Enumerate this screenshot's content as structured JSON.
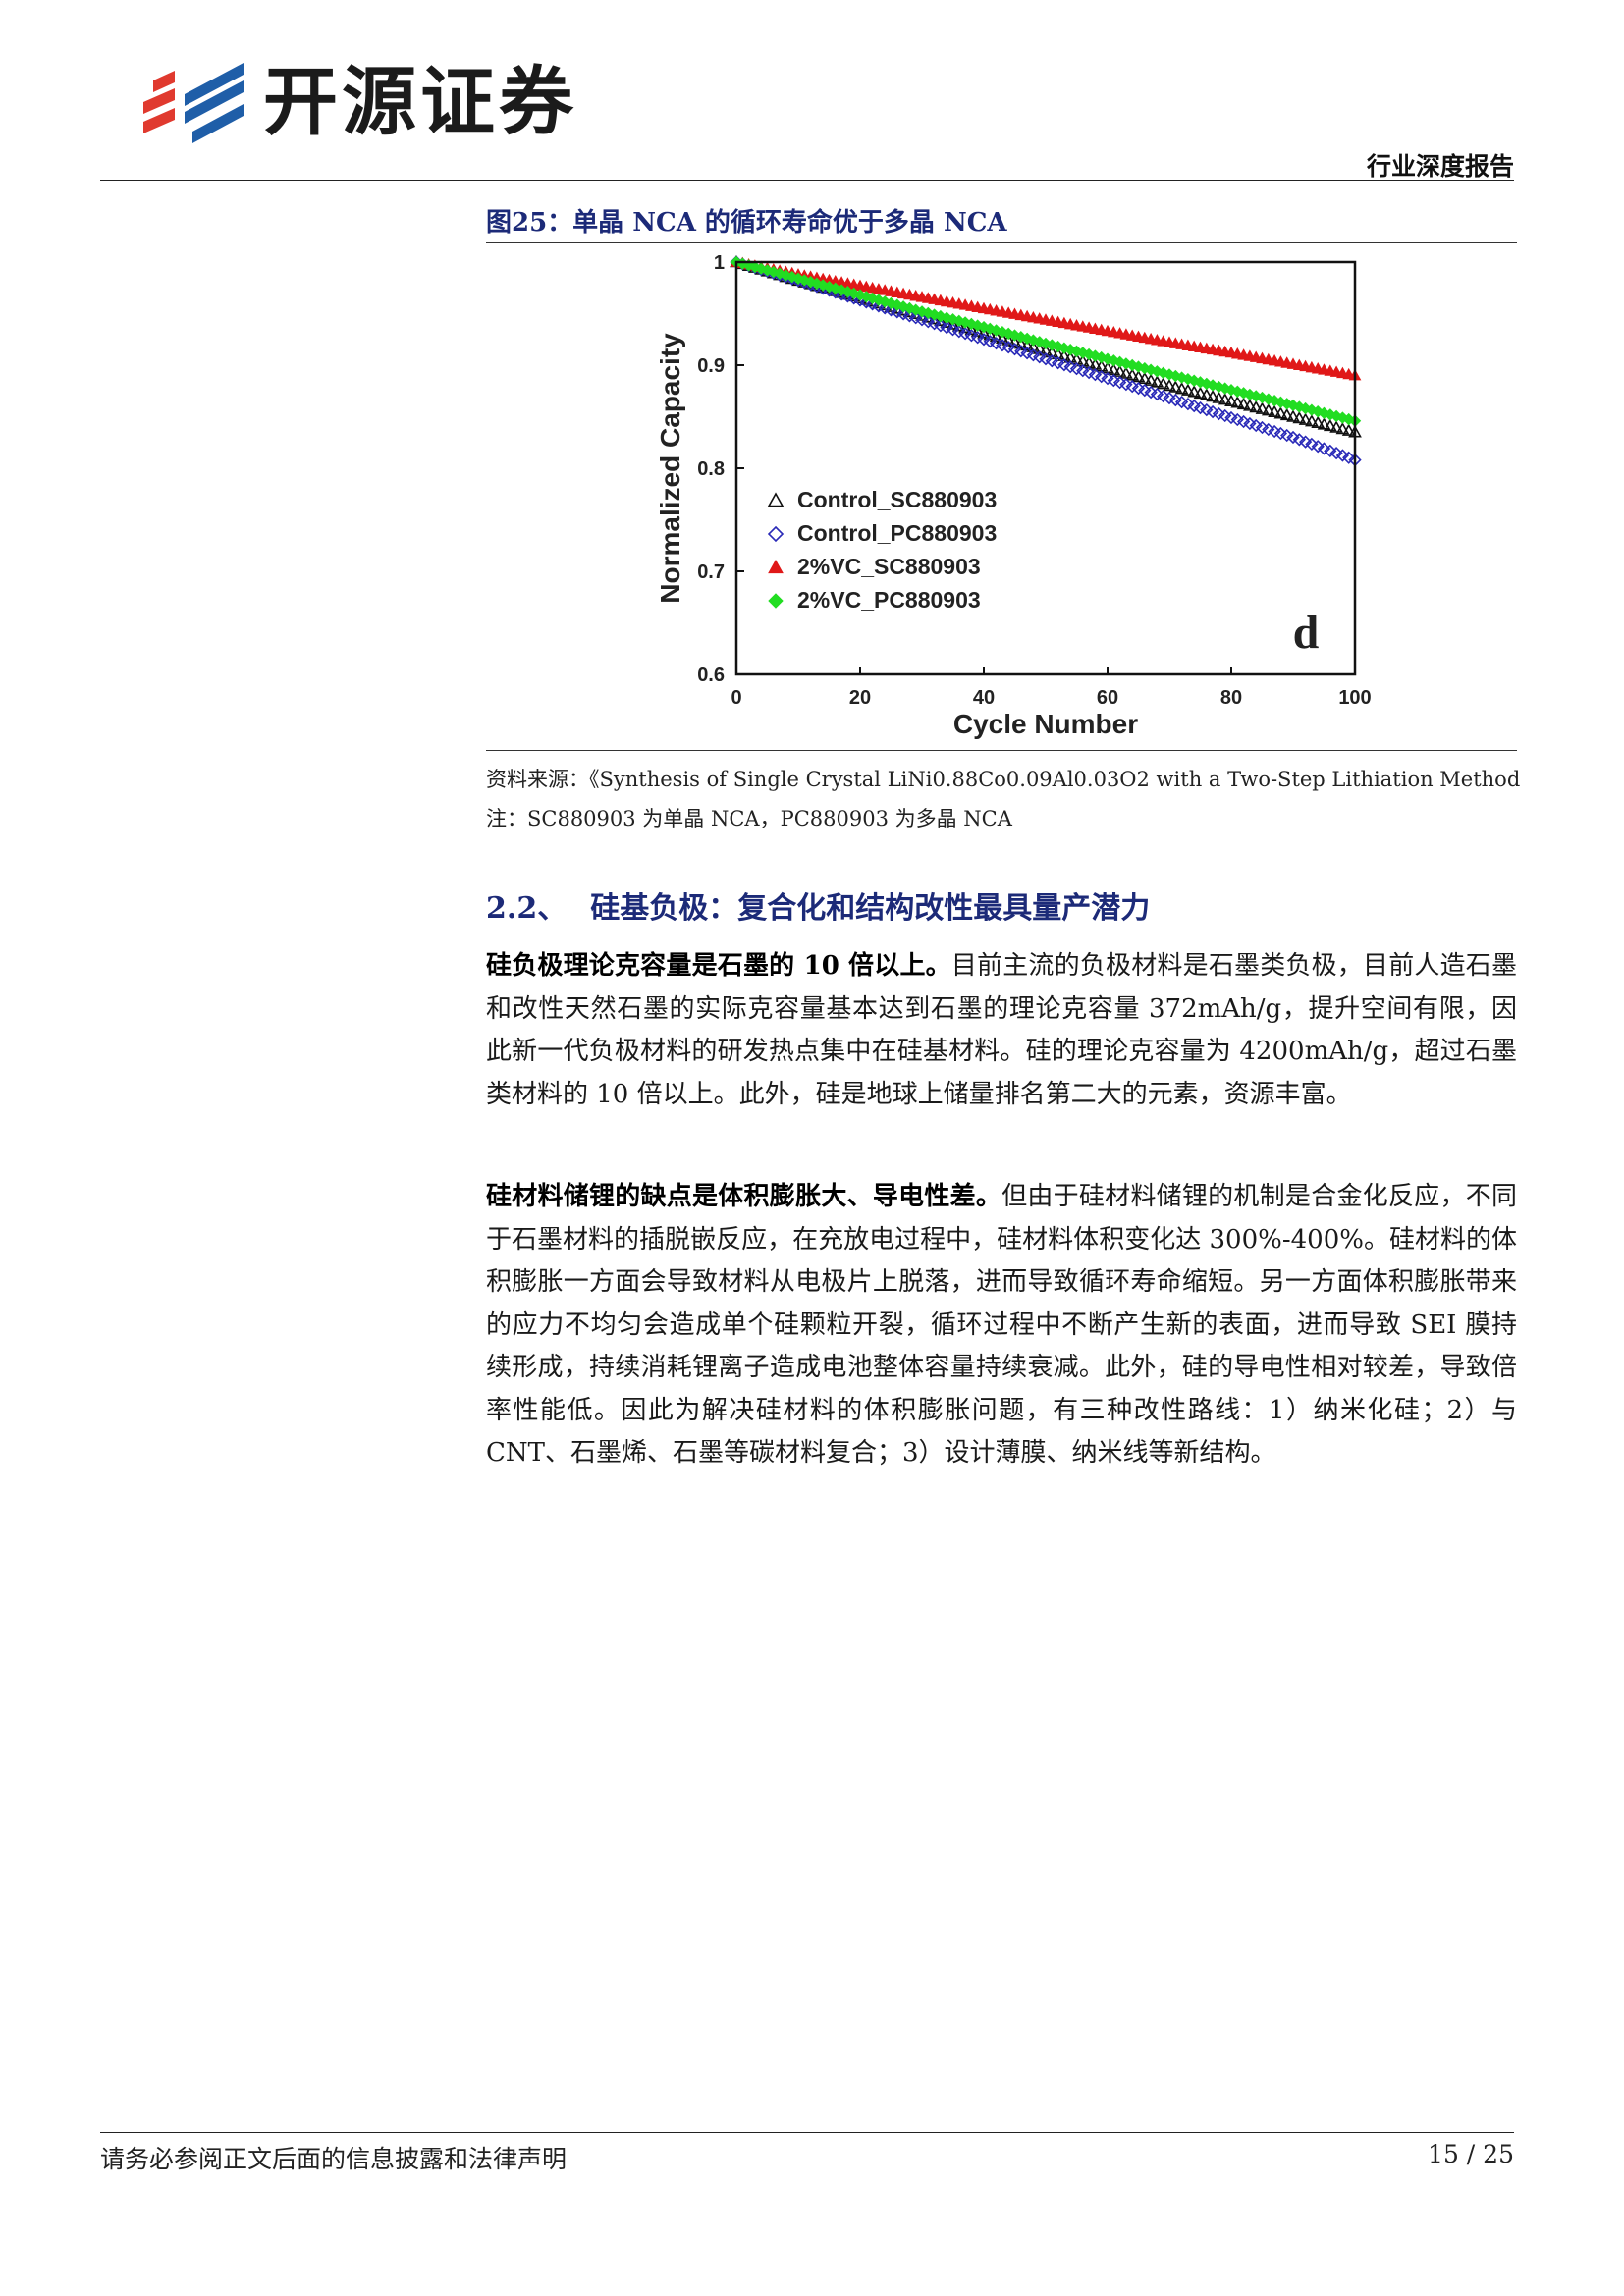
{
  "header": {
    "logo_text": "开源证券",
    "report_type": "行业深度报告",
    "logo_colors": {
      "red": "#e03a2f",
      "blue": "#1f5ea8"
    }
  },
  "figure": {
    "title": "图25：单晶 NCA 的循环寿命优于多晶 NCA",
    "source": "资料来源：《Synthesis of Single Crystal LiNi0.88Co0.09Al0.03O2 with a Two-Step Lithiation Method",
    "note": "注：SC880903 为单晶 NCA，PC880903 为多晶 NCA"
  },
  "chart_data": {
    "type": "scatter",
    "xlabel": "Cycle Number",
    "ylabel": "Normalized Capacity",
    "xlim": [
      0,
      100
    ],
    "ylim": [
      0.6,
      1.0
    ],
    "xticks": [
      0,
      20,
      40,
      60,
      80,
      100
    ],
    "yticks": [
      0.6,
      0.7,
      0.8,
      0.9,
      1
    ],
    "panel_label": "d",
    "legend_position": "lower-left",
    "grid": false,
    "series": [
      {
        "name": "Control_SC880903",
        "marker": "open-triangle",
        "color": "#111111",
        "x": [
          0,
          10,
          20,
          30,
          40,
          50,
          60,
          70,
          80,
          90,
          100
        ],
        "y": [
          1.0,
          0.982,
          0.965,
          0.948,
          0.931,
          0.914,
          0.897,
          0.88,
          0.865,
          0.85,
          0.835
        ]
      },
      {
        "name": "Control_PC880903",
        "marker": "open-diamond",
        "color": "#2a2ab8",
        "x": [
          0,
          10,
          20,
          30,
          40,
          50,
          60,
          70,
          80,
          90,
          100
        ],
        "y": [
          1.0,
          0.982,
          0.963,
          0.944,
          0.925,
          0.906,
          0.887,
          0.868,
          0.849,
          0.83,
          0.808
        ]
      },
      {
        "name": "2%VC_SC880903",
        "marker": "filled-triangle",
        "color": "#e01818",
        "x": [
          0,
          10,
          20,
          30,
          40,
          50,
          60,
          70,
          80,
          90,
          100
        ],
        "y": [
          1.0,
          0.988,
          0.977,
          0.966,
          0.955,
          0.944,
          0.933,
          0.922,
          0.912,
          0.901,
          0.89
        ]
      },
      {
        "name": "2%VC_PC880903",
        "marker": "filled-diamond",
        "color": "#22dd22",
        "x": [
          0,
          10,
          20,
          30,
          40,
          50,
          60,
          70,
          80,
          90,
          100
        ],
        "y": [
          1.0,
          0.984,
          0.968,
          0.952,
          0.937,
          0.921,
          0.906,
          0.891,
          0.876,
          0.861,
          0.846
        ]
      }
    ]
  },
  "section": {
    "number": "2.2、",
    "title": "硅基负极：复合化和结构改性最具量产潜力"
  },
  "paragraphs": {
    "p1_bold": "硅负极理论克容量是石墨的 10 倍以上。",
    "p1_text": "目前主流的负极材料是石墨类负极，目前人造石墨和改性天然石墨的实际克容量基本达到石墨的理论克容量 372mAh/g，提升空间有限，因此新一代负极材料的研发热点集中在硅基材料。硅的理论克容量为 4200mAh/g，超过石墨类材料的 10 倍以上。此外，硅是地球上储量排名第二大的元素，资源丰富。",
    "p2_bold": "硅材料储锂的缺点是体积膨胀大、导电性差。",
    "p2_text": "但由于硅材料储锂的机制是合金化反应，不同于石墨材料的插脱嵌反应，在充放电过程中，硅材料体积变化达 300%-400%。硅材料的体积膨胀一方面会导致材料从电极片上脱落，进而导致循环寿命缩短。另一方面体积膨胀带来的应力不均匀会造成单个硅颗粒开裂，循环过程中不断产生新的表面，进而导致 SEI 膜持续形成，持续消耗锂离子造成电池整体容量持续衰减。此外，硅的导电性相对较差，导致倍率性能低。因此为解决硅材料的体积膨胀问题，有三种改性路线：1）纳米化硅；2）与 CNT、石墨烯、石墨等碳材料复合；3）设计薄膜、纳米线等新结构。"
  },
  "footer": {
    "disclaimer": "请务必参阅正文后面的信息披露和法律声明",
    "page_number": "15 / 25"
  }
}
